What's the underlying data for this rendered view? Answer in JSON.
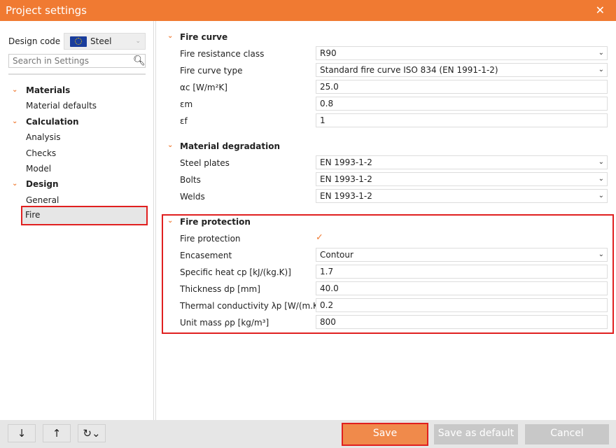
{
  "window": {
    "title": "Project settings",
    "close_icon": "close-icon"
  },
  "sidebar": {
    "design_code_label": "Design code",
    "design_code_value": "Steel",
    "search_placeholder": "Search in Settings",
    "tree": [
      {
        "label": "Materials",
        "head": true
      },
      {
        "label": "Material defaults"
      },
      {
        "label": "Calculation",
        "head": true
      },
      {
        "label": "Analysis"
      },
      {
        "label": "Checks"
      },
      {
        "label": "Model"
      },
      {
        "label": "Design",
        "head": true
      },
      {
        "label": "General"
      },
      {
        "label": "Fire",
        "selected": true
      }
    ]
  },
  "sections": {
    "fire_curve": {
      "title": "Fire curve",
      "rows": [
        {
          "label": "Fire resistance class",
          "value": "R90",
          "dropdown": true
        },
        {
          "label": "Fire curve type",
          "value": "Standard fire curve ISO 834 (EN 1991-1-2)",
          "dropdown": true
        },
        {
          "label": "αc [W/m²K]",
          "value": "25.0"
        },
        {
          "label": "εm",
          "value": "0.8"
        },
        {
          "label": "εf",
          "value": "1"
        }
      ]
    },
    "material_degradation": {
      "title": "Material degradation",
      "rows": [
        {
          "label": "Steel plates",
          "value": "EN 1993-1-2",
          "dropdown": true
        },
        {
          "label": "Bolts",
          "value": "EN 1993-1-2",
          "dropdown": true
        },
        {
          "label": "Welds",
          "value": "EN 1993-1-2",
          "dropdown": true
        }
      ]
    },
    "fire_protection": {
      "title": "Fire protection",
      "checkbox_label": "Fire protection",
      "checked": true,
      "rows": [
        {
          "label": "Encasement",
          "value": "Contour",
          "dropdown": true
        },
        {
          "label": "Specific heat cp [kJ/(kg.K)]",
          "value": "1.7"
        },
        {
          "label": "Thickness dp [mm]",
          "value": "40.0"
        },
        {
          "label": "Thermal conductivity λp [W/(m.K)]",
          "value": "0.2"
        },
        {
          "label": "Unit mass ρp [kg/m³]",
          "value": "800"
        }
      ]
    }
  },
  "footer": {
    "down": "↓",
    "up": "↑",
    "reset": "↻⌄",
    "save": "Save",
    "save_default": "Save as default",
    "cancel": "Cancel"
  },
  "colors": {
    "accent": "#f07a32",
    "highlight": "#e02020"
  }
}
